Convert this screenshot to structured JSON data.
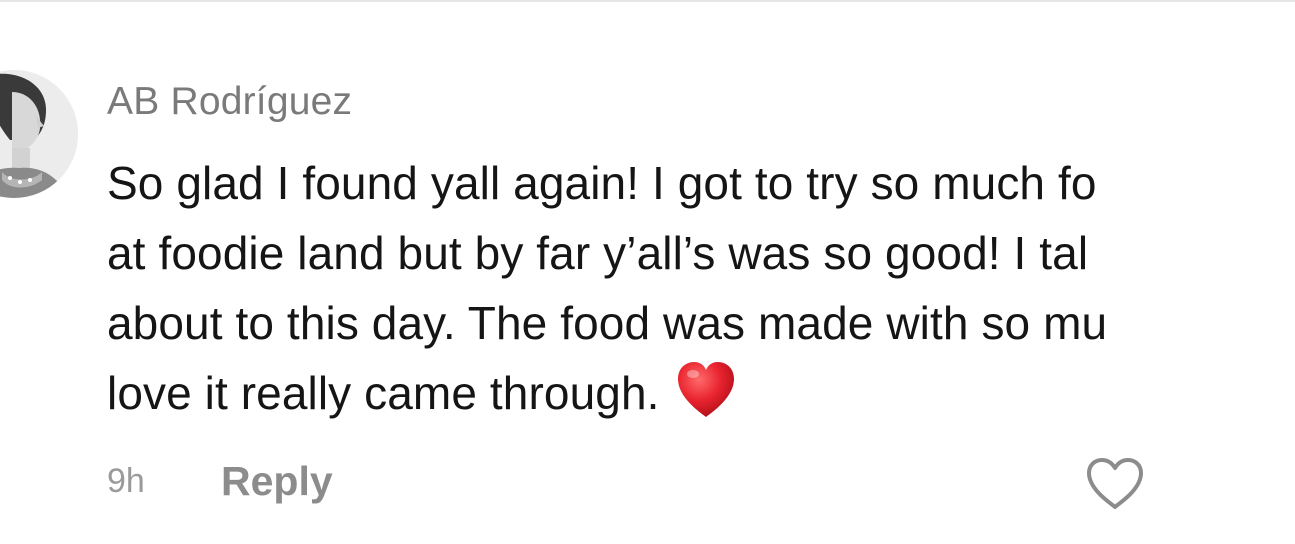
{
  "comment": {
    "username": "AB Rodríguez",
    "lines": [
      "So glad I found yall again! I got to try so much fo",
      "at foodie land but by far y’all’s was so good! I tal",
      "about to this day. The food was made with so mu",
      "love it really came through."
    ],
    "emoji": "red-heart-emoji",
    "time": "9h",
    "reply_label": "Reply",
    "like_icon": "heart-outline-icon"
  },
  "colors": {
    "username": "#7a7a7a",
    "body": "#151515",
    "meta": "#9a9a9a",
    "reply": "#8c8c8c",
    "heart_red": "#e8232e"
  }
}
